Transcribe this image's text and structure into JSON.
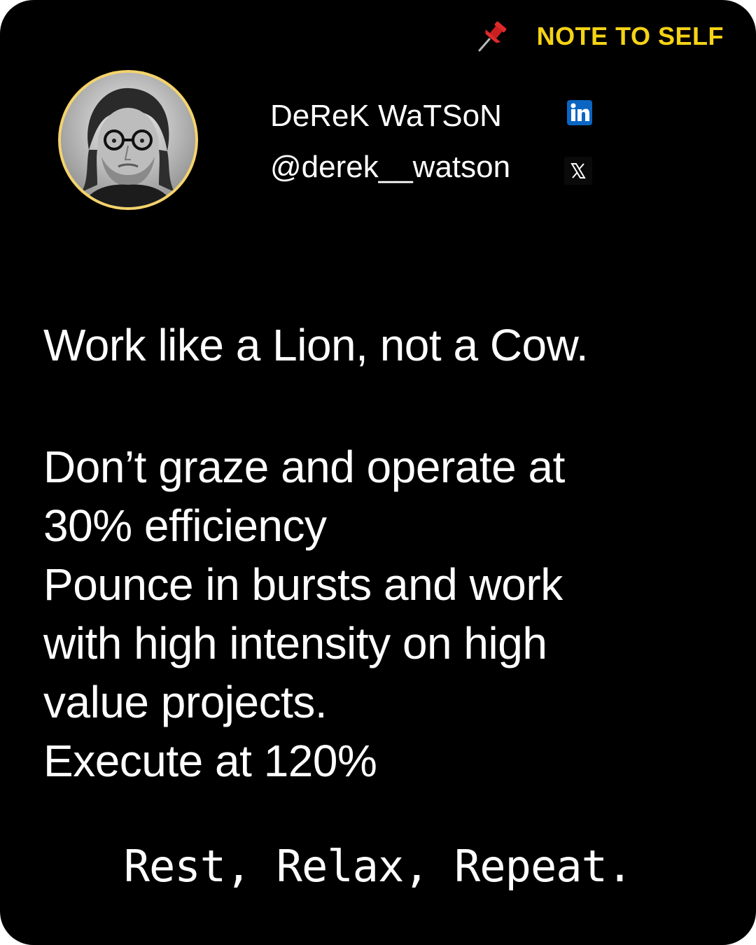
{
  "header": {
    "note_label": "NOTE TO SELF",
    "pin_icon": "pushpin-icon",
    "accent_color": "#f5d316"
  },
  "profile": {
    "name": "DeReK WaTSoN",
    "handle": "@derek__watson",
    "avatar": "avatar-portrait",
    "avatar_border_color": "#f4d36b",
    "social_icons": [
      "linkedin-icon",
      "x-icon"
    ],
    "linkedin_color": "#0a66c2"
  },
  "post": {
    "headline": "Work like a Lion, not a Cow.",
    "lines": [
      "Don’t graze and operate at",
      "30% efficiency",
      "Pounce in bursts and work",
      "with high intensity on high",
      "value projects.",
      "Execute at 120%"
    ],
    "tagline": "Rest, Relax, Repeat."
  },
  "theme": {
    "background": "#000000",
    "text_color": "#ffffff"
  }
}
